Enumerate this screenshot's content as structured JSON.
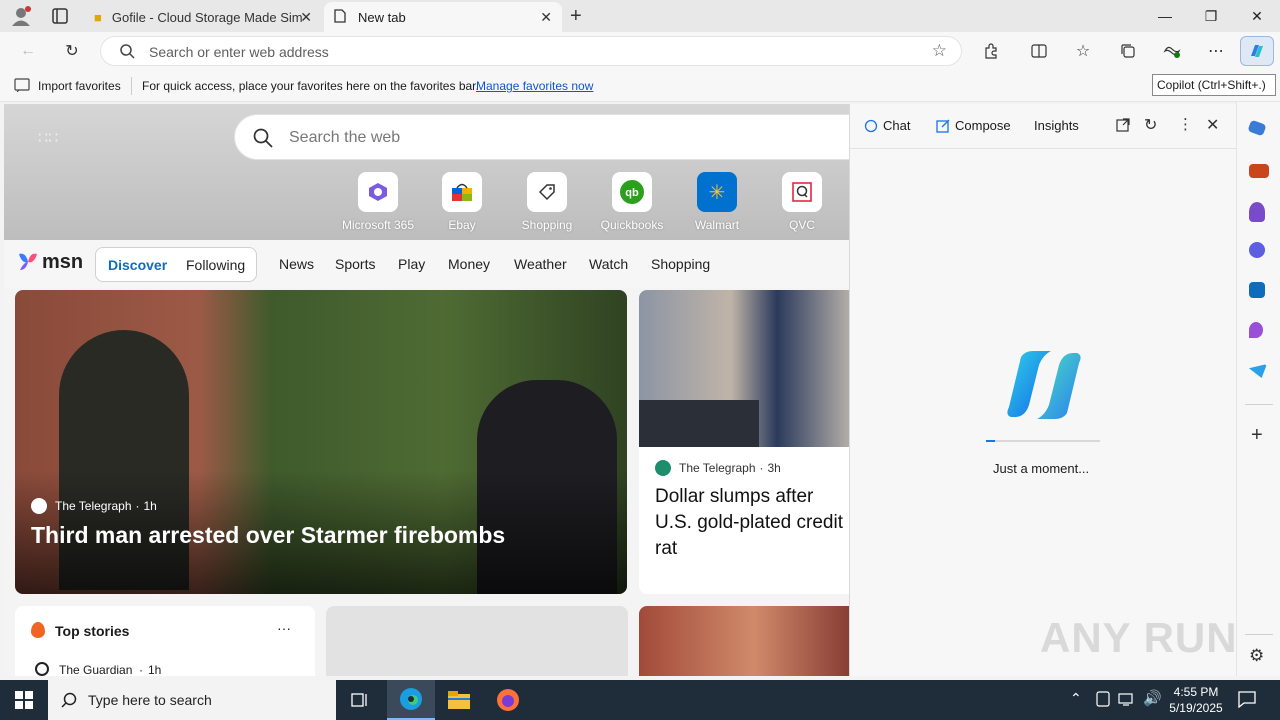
{
  "browser": {
    "tabs": [
      {
        "title": "Gofile - Cloud Storage Made Sim",
        "active": false
      },
      {
        "title": "New tab",
        "active": true
      }
    ],
    "address_placeholder": "Search or enter web address",
    "favorites": {
      "import_label": "Import favorites",
      "hint": "For quick access, place your favorites here on the favorites bar.",
      "manage_link": "Manage favorites now"
    },
    "tooltip": "Copilot (Ctrl+Shift+.)"
  },
  "newtab": {
    "search_placeholder": "Search the web",
    "quick_links": [
      {
        "label": "Microsoft 365",
        "icon": "m365-icon"
      },
      {
        "label": "Ebay",
        "icon": "ebay-icon"
      },
      {
        "label": "Shopping",
        "icon": "tag-icon"
      },
      {
        "label": "Quickbooks",
        "icon": "quickbooks-icon"
      },
      {
        "label": "Walmart",
        "icon": "walmart-icon"
      },
      {
        "label": "QVC",
        "icon": "qvc-icon"
      }
    ],
    "msn": {
      "logo": "msn",
      "pills": [
        "Discover",
        "Following"
      ],
      "nav": [
        "News",
        "Sports",
        "Play",
        "Money",
        "Weather",
        "Watch",
        "Shopping"
      ]
    },
    "cards": {
      "main": {
        "source": "The Telegraph",
        "age": "1h",
        "headline": "Third man arrested over Starmer firebombs"
      },
      "side": {
        "source": "The Telegraph",
        "age": "3h",
        "headline": "Dollar slumps after U.S. gold-plated credit rat"
      },
      "top_stories": {
        "title": "Top stories",
        "more": "···",
        "first_source": "The Guardian",
        "first_age": "1h"
      }
    }
  },
  "copilot": {
    "tabs": [
      "Chat",
      "Compose",
      "Insights"
    ],
    "status": "Just a moment...",
    "progress": 0.08
  },
  "taskbar": {
    "search_placeholder": "Type here to search",
    "time": "4:55 PM",
    "date": "5/19/2025"
  },
  "watermark": "ANY RUN"
}
